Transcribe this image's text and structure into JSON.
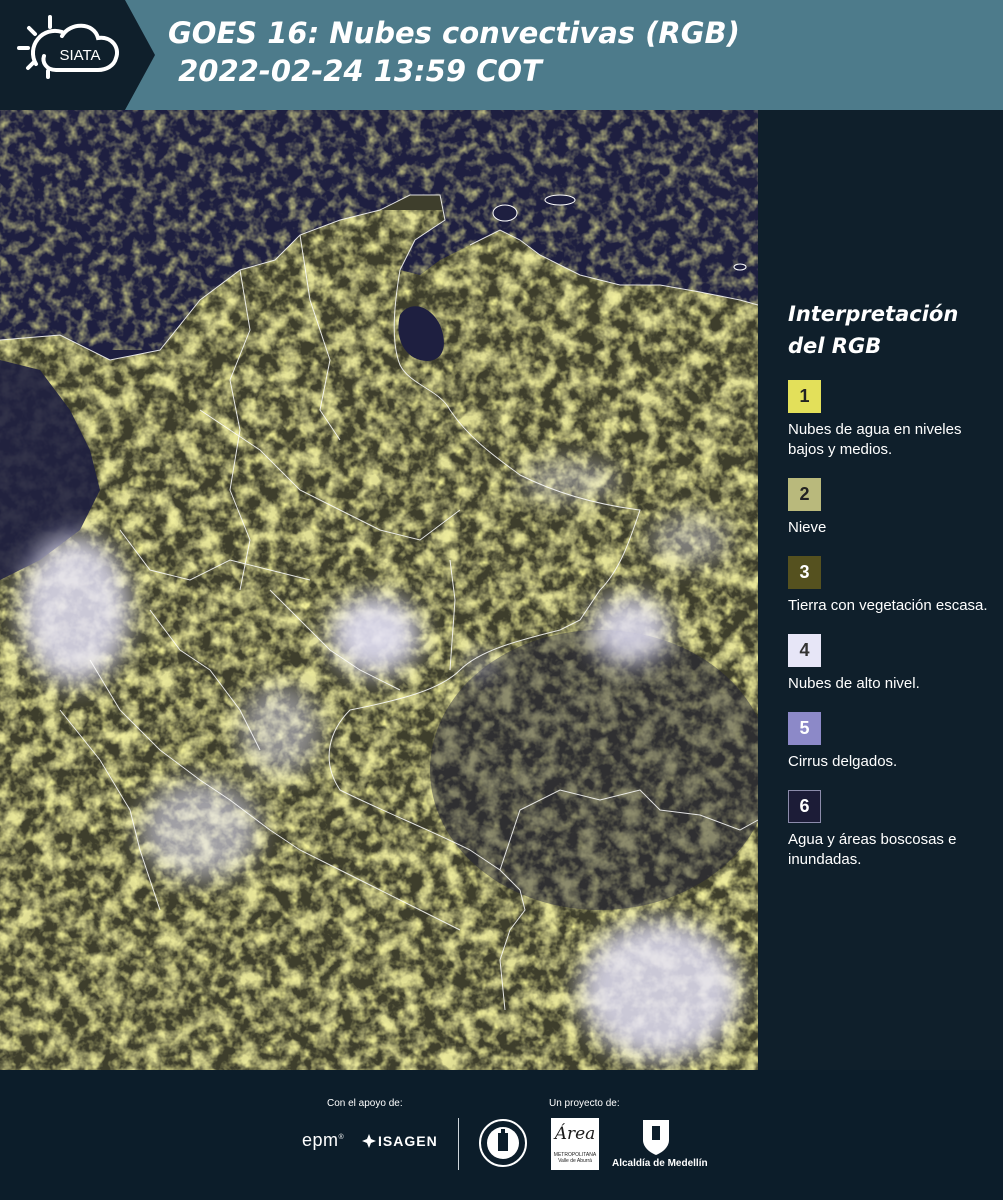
{
  "header": {
    "logo_text": "SIATA",
    "title_line1": "GOES 16: Nubes convectivas (RGB)",
    "title_line2": " 2022-02-24 13:59 COT",
    "logo_icon": "sun-cloud-icon",
    "background_color": "#4d7b8b"
  },
  "map": {
    "description_icon": "satellite-map",
    "colors": {
      "water": "#1e1f40",
      "yellow_cloud": "#d9d64a",
      "high_cloud": "#e4e2f6",
      "borders": "#ffffff"
    }
  },
  "legend": {
    "title_line1": "Interpretación",
    "title_line2": "del RGB",
    "items": [
      {
        "number": "1",
        "label": "Nubes de agua en niveles bajos y medios.",
        "color": "#e3e05a",
        "text_color": "#222222"
      },
      {
        "number": "2",
        "label": "Nieve",
        "color": "#b9b97c",
        "text_color": "#222222"
      },
      {
        "number": "3",
        "label": "Tierra con vegetación escasa.",
        "color": "#55511f",
        "text_color": "#ffffff"
      },
      {
        "number": "4",
        "label": "Nubes de alto nivel.",
        "color": "#e7e6f7",
        "text_color": "#333333"
      },
      {
        "number": "5",
        "label": "Cirrus delgados.",
        "color": "#8c89c8",
        "text_color": "#ffffff"
      },
      {
        "number": "6",
        "label": "Agua y áreas boscosas e inundadas.",
        "color": "#1c1c37",
        "text_color": "#ffffff"
      }
    ]
  },
  "footer": {
    "support_label": "Con el apoyo de:",
    "project_label": "Un proyecto de:",
    "epm_logo": "epm",
    "isagen_logo": "ISAGEN",
    "area_logo_main": "Área",
    "area_logo_sub1": "METROPOLITANA",
    "area_logo_sub2": "Valle de Aburrá",
    "alcaldia_logo": "Alcaldía de Medellín"
  }
}
